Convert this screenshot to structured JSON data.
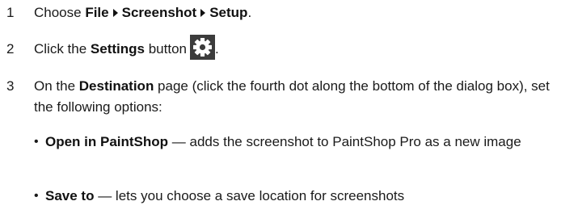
{
  "steps": [
    {
      "number": "1",
      "prefix": "Choose ",
      "menu_path": [
        "File",
        "Screenshot",
        "Setup"
      ],
      "suffix": "."
    },
    {
      "number": "2",
      "prefix": "Click the ",
      "bold": "Settings",
      "middle": " button",
      "icon": "gear-icon",
      "suffix": "."
    },
    {
      "number": "3",
      "prefix": "On the ",
      "bold": "Destination",
      "text": " page (click the fourth dot along the bottom of the dialog box), set the following options:"
    }
  ],
  "options": [
    {
      "bullet": "•",
      "label": "Open in PaintShop",
      "description": " — adds the screenshot to PaintShop Pro as a new image"
    },
    {
      "bullet": "•",
      "label": "Save to",
      "description": " — lets you choose a save location for screenshots"
    }
  ],
  "colors": {
    "text": "#1a1a1a",
    "icon_background": "#3c3c3c",
    "icon_foreground": "#ffffff"
  }
}
